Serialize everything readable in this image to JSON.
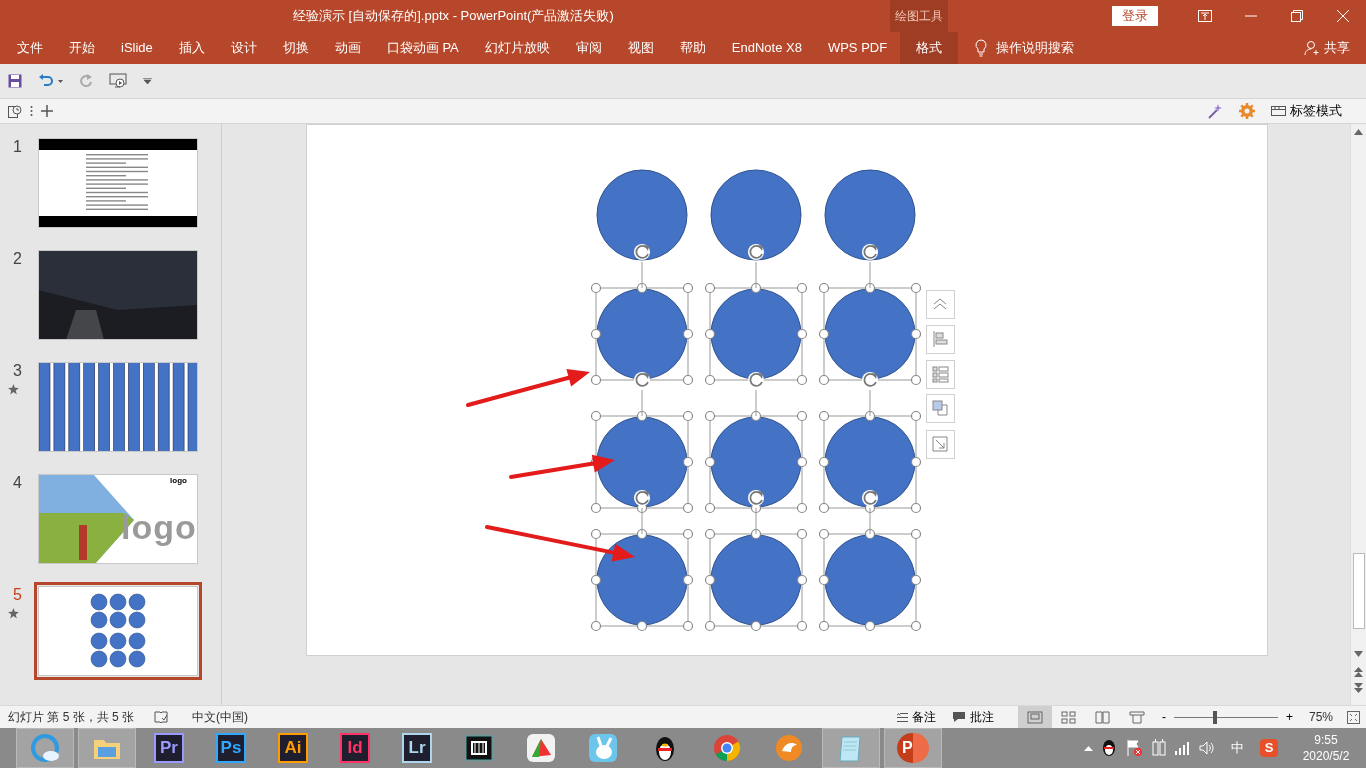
{
  "window": {
    "title": "经验演示 [自动保存的].pptx  -  PowerPoint(产品激活失败)",
    "context_group": "绘图工具",
    "login": "登录"
  },
  "ribbon_tabs": [
    {
      "label": "文件",
      "selected": false
    },
    {
      "label": "开始",
      "selected": false
    },
    {
      "label": "iSlide",
      "selected": false
    },
    {
      "label": "插入",
      "selected": false
    },
    {
      "label": "设计",
      "selected": false
    },
    {
      "label": "切换",
      "selected": false
    },
    {
      "label": "动画",
      "selected": false
    },
    {
      "label": "口袋动画 PA",
      "selected": false
    },
    {
      "label": "幻灯片放映",
      "selected": false
    },
    {
      "label": "审阅",
      "selected": false
    },
    {
      "label": "视图",
      "selected": false
    },
    {
      "label": "帮助",
      "selected": false
    },
    {
      "label": "EndNote X8",
      "selected": false
    },
    {
      "label": "WPS PDF",
      "selected": false
    },
    {
      "label": "格式",
      "selected": true
    }
  ],
  "tell_me": "操作说明搜索",
  "share": "共享",
  "toolbar": {
    "tab_mode": "标签模式"
  },
  "slides": [
    {
      "number": "1",
      "animated": false,
      "selected": false,
      "kind": "text-doc"
    },
    {
      "number": "2",
      "animated": false,
      "selected": false,
      "kind": "photo"
    },
    {
      "number": "3",
      "animated": true,
      "selected": false,
      "kind": "stripes"
    },
    {
      "number": "4",
      "animated": false,
      "selected": false,
      "kind": "photo-logo",
      "corner_text": "logo",
      "big_text": "logo"
    },
    {
      "number": "5",
      "animated": true,
      "selected": true,
      "kind": "circles"
    }
  ],
  "canvas": {
    "shapes": [
      {
        "selected": false
      },
      {
        "selected": false
      },
      {
        "selected": false
      },
      {
        "selected": true
      },
      {
        "selected": true
      },
      {
        "selected": true
      },
      {
        "selected": true
      },
      {
        "selected": true
      },
      {
        "selected": true
      },
      {
        "selected": true
      },
      {
        "selected": true
      },
      {
        "selected": true
      }
    ]
  },
  "status_bar": {
    "slide_info": "幻灯片 第 5 张，共 5 张",
    "language": "中文(中国)",
    "notes": "备注",
    "comments": "批注",
    "views": [
      {
        "selected": true
      },
      {
        "selected": false
      },
      {
        "selected": false
      },
      {
        "selected": false
      }
    ],
    "zoom_minus": "-",
    "zoom_plus": "+",
    "zoom": {
      "level": 0.38
    },
    "zoom_reading": "75%"
  },
  "taskbar": {
    "apps": [
      {
        "kind": "browser",
        "running": true
      },
      {
        "kind": "folder",
        "running": true
      },
      {
        "kind": "adobe",
        "label": "Pr",
        "color": "#9999ff"
      },
      {
        "kind": "adobe",
        "label": "Ps",
        "color": "#31a8ff"
      },
      {
        "kind": "adobe",
        "label": "Ai",
        "color": "#ff9a00"
      },
      {
        "kind": "adobe",
        "label": "Id",
        "color": "#ff3366"
      },
      {
        "kind": "adobe",
        "label": "Lr",
        "color": "#add5ec"
      },
      {
        "kind": "video",
        "running": false
      },
      {
        "kind": "umbrella",
        "running": false
      },
      {
        "kind": "rabbit",
        "running": false
      },
      {
        "kind": "penguin",
        "running": false
      },
      {
        "kind": "chrome",
        "running": false
      },
      {
        "kind": "fox",
        "running": false
      },
      {
        "kind": "notepad",
        "running": true
      },
      {
        "kind": "powerpoint",
        "label": "P",
        "running": true
      }
    ],
    "ime": "中",
    "input_app": "S",
    "time": "9:55",
    "date": "2020/5/2"
  }
}
